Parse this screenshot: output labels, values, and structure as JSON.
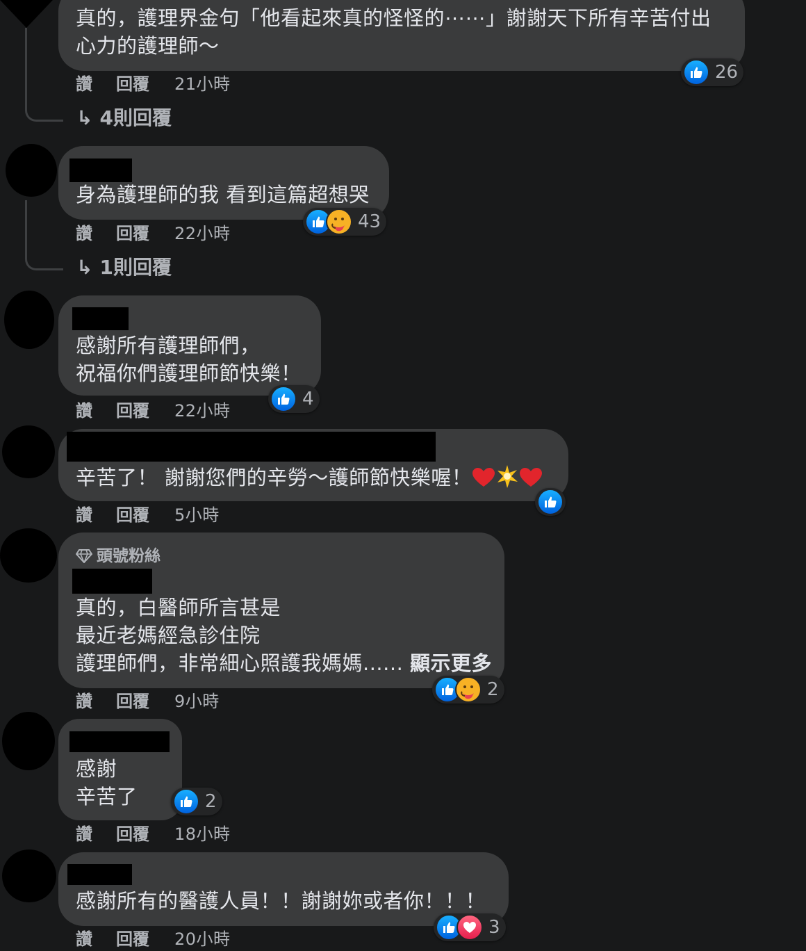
{
  "actions": {
    "like": "讚",
    "reply": "回覆"
  },
  "comments": [
    {
      "lines": [
        "真的，護理界金句「他看起來真的怪怪的⋯⋯」謝謝天下所有辛苦付出",
        "心力的護理師～"
      ],
      "time": "21小時",
      "reactions": {
        "icons": [
          "like"
        ],
        "count": "26"
      },
      "replies": "4則回覆"
    },
    {
      "lines": [
        "身為護理師的我 看到這篇超想哭"
      ],
      "time": "22小時",
      "reactions": {
        "icons": [
          "like",
          "care"
        ],
        "count": "43"
      },
      "replies": "1則回覆"
    },
    {
      "lines": [
        "感謝所有護理師們，",
        "祝福你們護理師節快樂！"
      ],
      "time": "22小時",
      "reactions": {
        "icons": [
          "like"
        ],
        "count": "4"
      }
    },
    {
      "lines": [
        "辛苦了！ 謝謝您們的辛勞～護師節快樂喔！"
      ],
      "emojis": [
        "heart",
        "sparkle",
        "heart"
      ],
      "time": "5小時",
      "reactions": {
        "icons": [
          "like"
        ],
        "count": ""
      }
    },
    {
      "badge": "頭號粉絲",
      "lines": [
        "真的，白醫師所言甚是",
        "最近老媽經急診住院",
        "護理師們，非常細心照護我媽媽......"
      ],
      "see_more": "顯示更多",
      "time": "9小時",
      "reactions": {
        "icons": [
          "like",
          "care"
        ],
        "count": "2"
      }
    },
    {
      "lines": [
        "感謝",
        "辛苦了"
      ],
      "time": "18小時",
      "reactions": {
        "icons": [
          "like"
        ],
        "count": "2"
      }
    },
    {
      "lines": [
        "感謝所有的醫護人員！！謝謝妳或者你！！！"
      ],
      "time": "20小時",
      "reactions": {
        "icons": [
          "like",
          "love"
        ],
        "count": "3"
      }
    }
  ]
}
